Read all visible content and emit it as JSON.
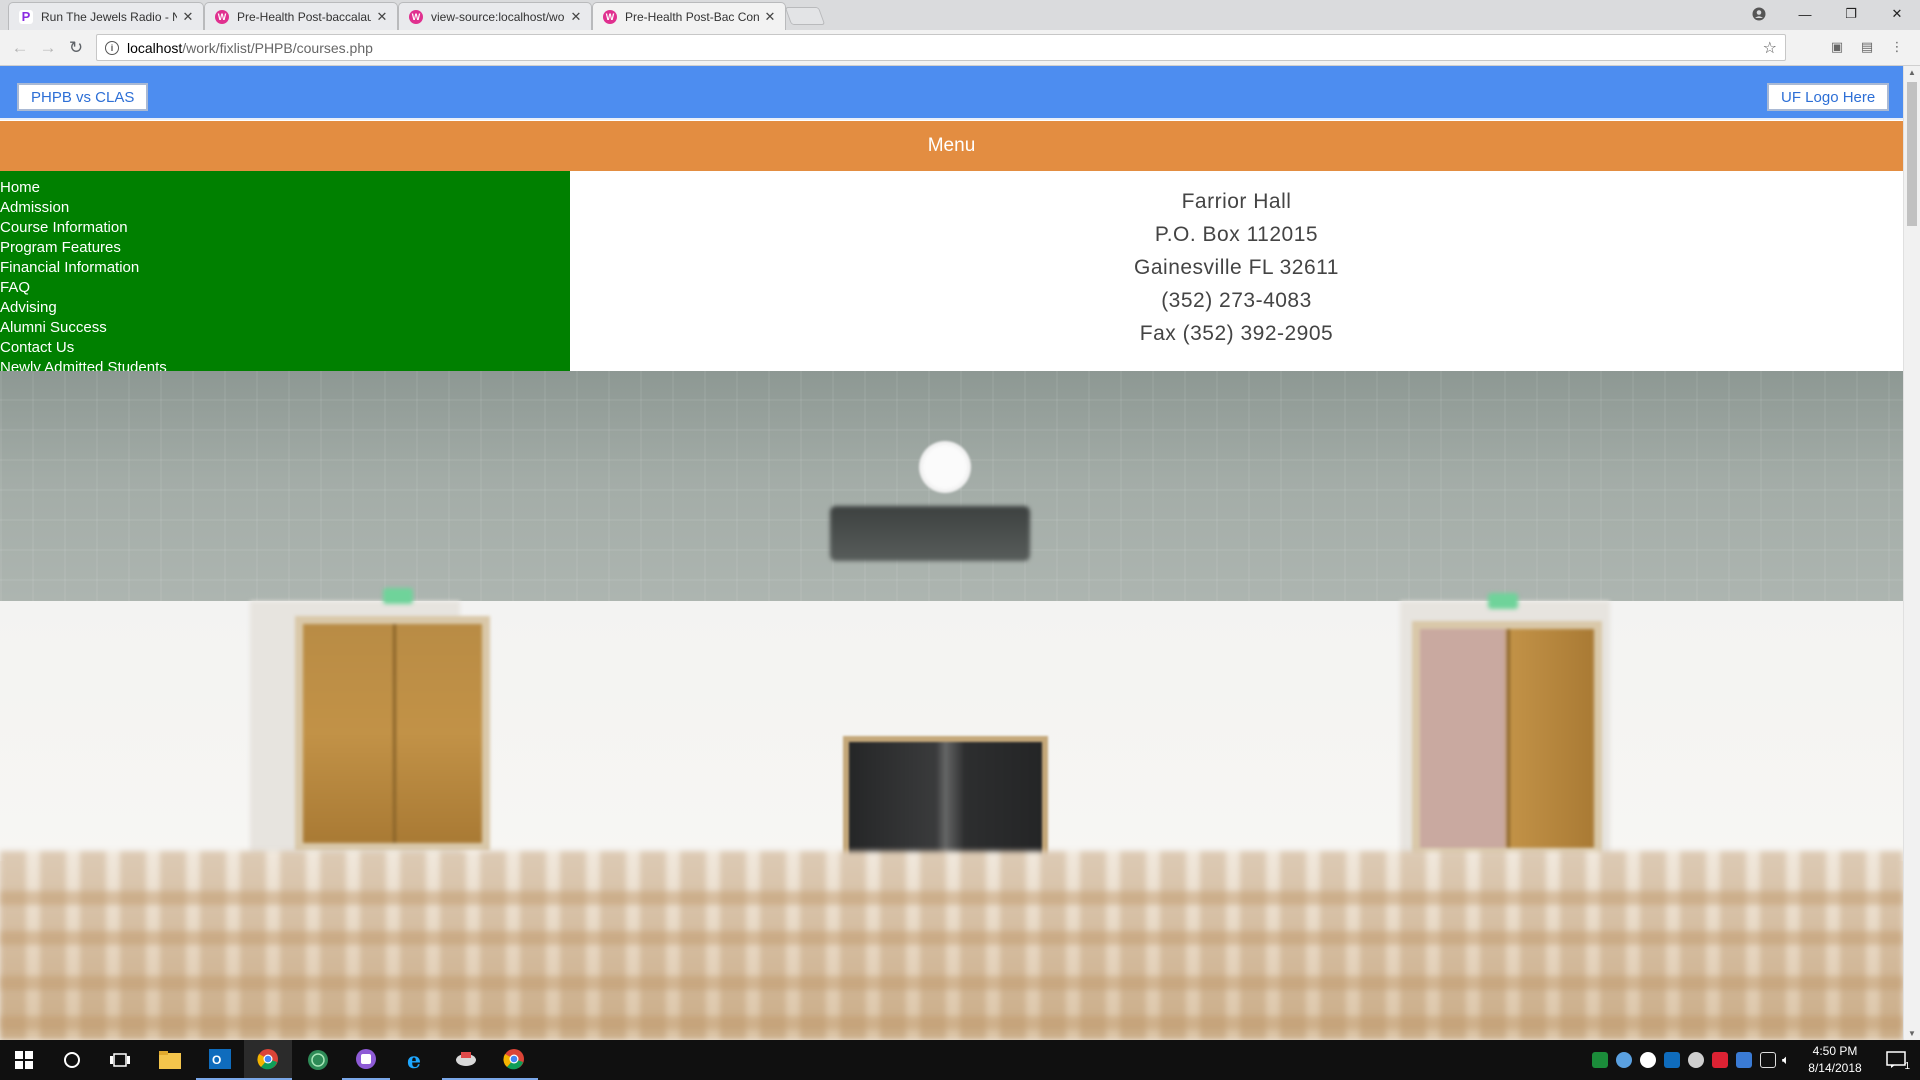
{
  "browser": {
    "tabs": [
      {
        "title": "Run The Jewels Radio - N",
        "favicon": "pandora-icon"
      },
      {
        "title": "Pre-Health Post-baccalau",
        "favicon": "w-icon"
      },
      {
        "title": "view-source:localhost/wo",
        "favicon": "w-icon"
      },
      {
        "title": "Pre-Health Post-Bac Con",
        "favicon": "w-icon",
        "active": true
      }
    ],
    "url_host": "localhost",
    "url_path": "/work/fixlist/PHPB/courses.php"
  },
  "page": {
    "left_button": "PHPB vs CLAS",
    "right_button": "UF Logo Here",
    "menu_title": "Menu",
    "nav_items": [
      "Home",
      "Admission",
      "Course Information",
      "Program Features",
      "Financial Information",
      "FAQ",
      "Advising",
      "Alumni Success",
      "Contact Us",
      "Newly Admitted Students"
    ],
    "address": [
      "Farrior Hall",
      "P.O. Box 112015",
      "Gainesville FL 32611",
      "(352) 273-4083",
      "Fax (352) 392-2905"
    ],
    "colors": {
      "topbar": "#4d8df0",
      "menubar": "#e38d41",
      "sidenav": "#008000"
    }
  },
  "taskbar": {
    "time": "4:50 PM",
    "date": "8/14/2018",
    "notification_count": "1"
  }
}
